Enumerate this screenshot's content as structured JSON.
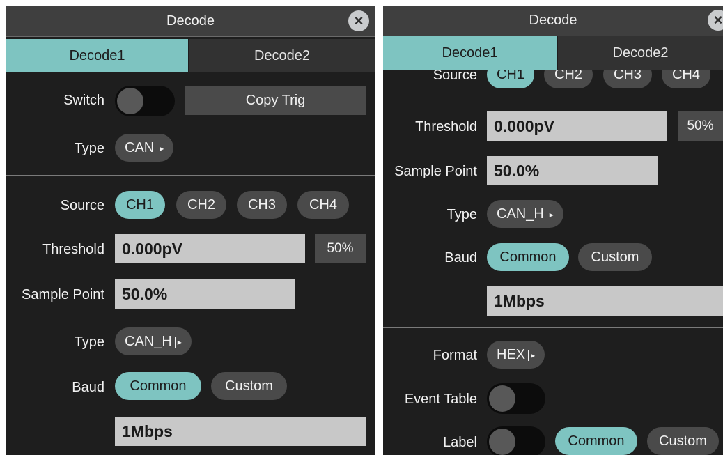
{
  "left": {
    "title": "Decode",
    "close_glyph": "×",
    "tabs": [
      "Decode1",
      "Decode2"
    ],
    "switch_label": "Switch",
    "copy_trig_label": "Copy Trig",
    "type_label": "Type",
    "type_value": "CAN",
    "source_label": "Source",
    "sources": [
      "CH1",
      "CH2",
      "CH3",
      "CH4"
    ],
    "threshold_label": "Threshold",
    "threshold_value": "0.000pV",
    "threshold_pct": "50%",
    "sample_point_label": "Sample Point",
    "sample_point_value": "50.0%",
    "signal_type_label": "Type",
    "signal_type_value": "CAN_H",
    "baud_label": "Baud",
    "baud_options": [
      "Common",
      "Custom"
    ],
    "baud_value": "1Mbps"
  },
  "right": {
    "title": "Decode",
    "close_glyph": "×",
    "tabs": [
      "Decode1",
      "Decode2"
    ],
    "source_label": "Source",
    "sources": [
      "CH1",
      "CH2",
      "CH3",
      "CH4"
    ],
    "threshold_label": "Threshold",
    "threshold_value": "0.000pV",
    "threshold_pct": "50%",
    "sample_point_label": "Sample Point",
    "sample_point_value": "50.0%",
    "signal_type_label": "Type",
    "signal_type_value": "CAN_H",
    "baud_label": "Baud",
    "baud_options": [
      "Common",
      "Custom"
    ],
    "baud_value": "1Mbps",
    "format_label": "Format",
    "format_value": "HEX",
    "event_table_label": "Event Table",
    "label_label": "Label",
    "label_options": [
      "Common",
      "Custom"
    ]
  },
  "state": {
    "switch_on": false,
    "event_table_on": false,
    "label_on": false,
    "active_tab": "Decode1",
    "active_source": "CH1",
    "active_baud": "Common",
    "active_label_mode": "Common"
  },
  "colors": {
    "accent": "#7ec4c1",
    "background": "#1e1e1e",
    "header": "#3f3f3f",
    "pill": "#4a4a4a",
    "field": "#c8c8c8"
  }
}
